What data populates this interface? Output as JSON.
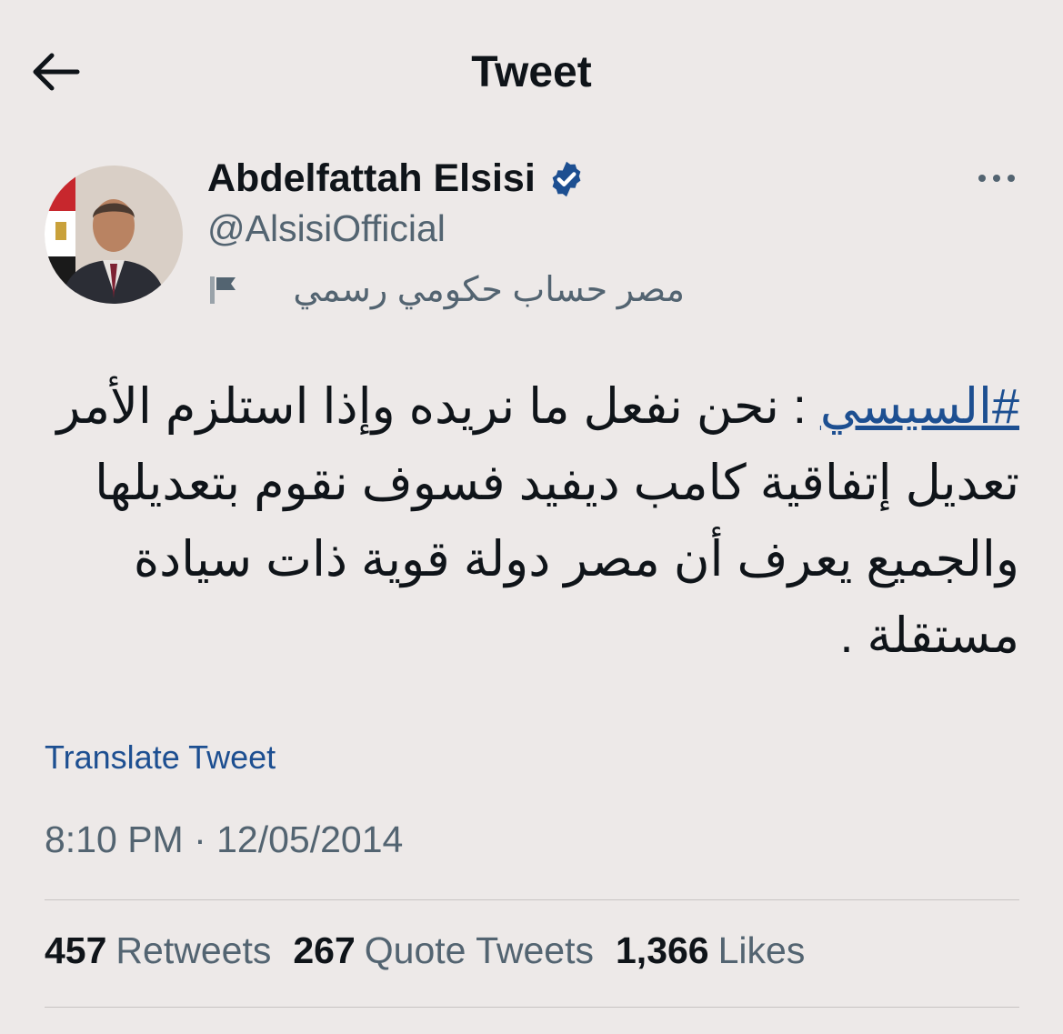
{
  "header": {
    "title": "Tweet"
  },
  "author": {
    "name": "Abdelfattah Elsisi",
    "handle": "@AlsisiOfficial",
    "label": "مصر حساب حكومي رسمي"
  },
  "tweet": {
    "hashtag": "#السيسي",
    "body": " : نحن نفعل ما نريده وإذا استلزم الأمر تعديل إتفاقية كامب ديفيد فسوف نقوم بتعديلها والجميع يعرف أن مصر دولة قوية ذات سيادة مستقلة ."
  },
  "translate_label": "Translate Tweet",
  "timestamp": "8:10 PM · 12/05/2014",
  "stats": {
    "retweets": {
      "count": "457",
      "label": "Retweets"
    },
    "quotes": {
      "count": "267",
      "label": "Quote Tweets"
    },
    "likes": {
      "count": "1,366",
      "label": "Likes"
    }
  },
  "colors": {
    "link": "#1d4f91",
    "background": "#ede9e8",
    "muted": "#536471",
    "verified": "#1d4f91"
  },
  "icons": {
    "back": "arrow-left-icon",
    "verified": "verified-badge-icon",
    "more": "more-horizontal-icon",
    "flag": "flag-icon"
  }
}
